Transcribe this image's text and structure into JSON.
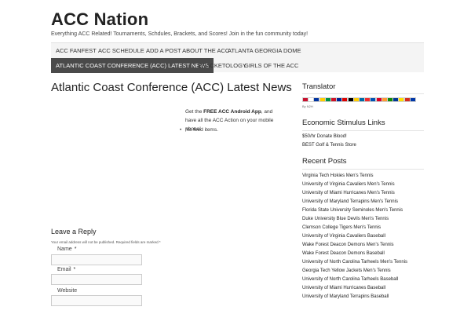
{
  "site": {
    "title": "ACC Nation",
    "description": "Everything ACC Related! Tournaments, Schdules, Brackets, and Scores! Join in the fun community today!"
  },
  "nav": {
    "items": [
      {
        "label": "ACC FANFEST"
      },
      {
        "label": "ACC SCHEDULE"
      },
      {
        "label": "ADD A POST ABOUT THE ACC"
      },
      {
        "label": "ATLANTA GEORGIA DOME"
      },
      {
        "label": "ATLANTIC COAST CONFERENCE (ACC) LATEST NEWS"
      },
      {
        "label": "BRACKETOLOGY"
      },
      {
        "label": "GIRLS OF THE ACC"
      }
    ]
  },
  "main": {
    "page_title": "Atlantic Coast Conference (ACC) Latest News",
    "promo_prefix": "Get the ",
    "promo_bold": "FREE ACC Android App",
    "promo_suffix": ", and have all the ACC Action on your mobile phone!",
    "feed_empty": "No feed items."
  },
  "reply": {
    "title": "Leave a Reply",
    "note": "Your email address will not be published. Required fields are marked *",
    "fields": [
      {
        "label": "Name",
        "required": "*"
      },
      {
        "label": "Email",
        "required": "*"
      },
      {
        "label": "Website"
      }
    ]
  },
  "sidebar": {
    "translator": {
      "title": "Translator",
      "powered_by": "By N2H",
      "flag_colors": [
        "#c8102e",
        "#ffffff",
        "#0033a0",
        "#ffce00",
        "#009246",
        "#ce1126",
        "#002395",
        "#dd0000",
        "#000000",
        "#ffcc00",
        "#006aa7",
        "#ef2b2d",
        "#0052b4",
        "#d80027",
        "#ff9933",
        "#138808",
        "#003893",
        "#ffde00",
        "#d52b1e",
        "#0038a8"
      ]
    },
    "economic": {
      "title": "Economic Stimulus Links",
      "links": [
        "$50/hr Donate Blood!",
        "BEST Golf & Tennis Store"
      ]
    },
    "recent": {
      "title": "Recent Posts",
      "links": [
        "Virginia Tech Hokies Men's Tennis",
        "University of Virginia Cavaliers Men's Tennis",
        "University of Miami Hurricanes Men's Tennis",
        "University of Maryland Terrapins Men's Tennis",
        "Florida State University Seminoles Men's Tennis",
        "Duke University Blue Devils Men's Tennis",
        "Clemson College Tigers Men's Tennis",
        "University of Virginia Cavaliers Baseball",
        "Wake Forest Deacon Demons Men's Tennis",
        "Wake Forest Deacon Demons Baseball",
        "University of North Carolina Tarheels Men's Tennis",
        "Georgia Tech Yellow Jackets Men's Tennis",
        "University of North Carolina Tarheels Baseball",
        "University of Miami Hurricanes Baseball",
        "University of Maryland Terrapins Baseball"
      ]
    }
  }
}
